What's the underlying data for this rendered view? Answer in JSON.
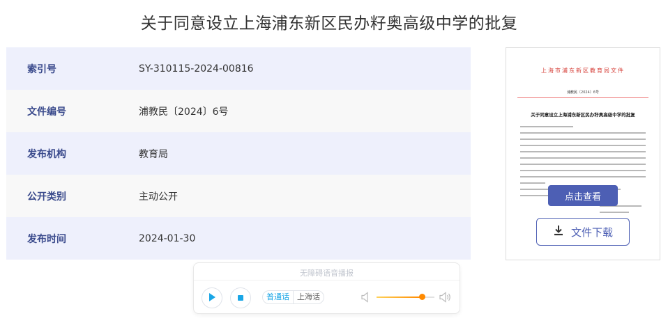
{
  "page_title": "关于同意设立上海浦东新区民办籽奥高级中学的批复",
  "meta_rows": [
    {
      "label": "索引号",
      "value": "SY-310115-2024-00816"
    },
    {
      "label": "文件编号",
      "value": "浦教民〔2024〕6号"
    },
    {
      "label": "发布机构",
      "value": "教育局"
    },
    {
      "label": "公开类别",
      "value": "主动公开"
    },
    {
      "label": "发布时间",
      "value": "2024-01-30"
    }
  ],
  "doc_preview": {
    "header": "上海市浦东新区教育局文件",
    "doc_number": "浦教民〔2024〕6号",
    "doc_title": "关于同意设立上海浦东新区民办籽奥高级中学的批复"
  },
  "actions": {
    "view_label": "点击查看",
    "download_label": "文件下载"
  },
  "audio_player": {
    "title": "无障碍语音播报",
    "tabs": [
      "普通话",
      "上海话"
    ],
    "active_tab": "普通话",
    "volume_level": 0.78,
    "colors": {
      "accent": "#1aa6e6",
      "volume": "#ff8a00"
    }
  },
  "colors": {
    "label_text": "#3a4a8c",
    "row_alt_bg": "#eef0fc",
    "button_bg": "#4d5fb4",
    "doc_header": "#d6403a"
  },
  "icons": {
    "play": "play-icon",
    "stop": "stop-icon",
    "download": "download-icon",
    "volume_low": "volume-low-icon",
    "volume_high": "volume-high-icon"
  }
}
